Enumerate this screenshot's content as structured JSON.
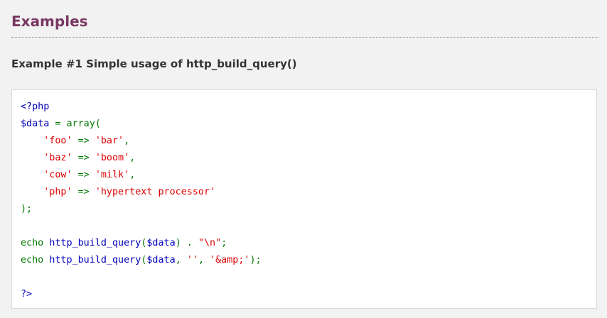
{
  "section": {
    "title": "Examples"
  },
  "example": {
    "title": "Example #1 Simple usage of http_build_query()"
  },
  "code": {
    "lines": [
      [
        {
          "text": "<?php",
          "class": "tok-keyword"
        }
      ],
      [
        {
          "text": "$data",
          "class": "tok-keyword"
        },
        {
          "text": " = array(",
          "class": "tok-default"
        }
      ],
      [
        {
          "text": "    ",
          "class": "tok-default"
        },
        {
          "text": "'foo'",
          "class": "tok-string"
        },
        {
          "text": " => ",
          "class": "tok-default"
        },
        {
          "text": "'bar'",
          "class": "tok-string"
        },
        {
          "text": ",",
          "class": "tok-default"
        }
      ],
      [
        {
          "text": "    ",
          "class": "tok-default"
        },
        {
          "text": "'baz'",
          "class": "tok-string"
        },
        {
          "text": " => ",
          "class": "tok-default"
        },
        {
          "text": "'boom'",
          "class": "tok-string"
        },
        {
          "text": ",",
          "class": "tok-default"
        }
      ],
      [
        {
          "text": "    ",
          "class": "tok-default"
        },
        {
          "text": "'cow'",
          "class": "tok-string"
        },
        {
          "text": " => ",
          "class": "tok-default"
        },
        {
          "text": "'milk'",
          "class": "tok-string"
        },
        {
          "text": ",",
          "class": "tok-default"
        }
      ],
      [
        {
          "text": "    ",
          "class": "tok-default"
        },
        {
          "text": "'php'",
          "class": "tok-string"
        },
        {
          "text": " => ",
          "class": "tok-default"
        },
        {
          "text": "'hypertext processor'",
          "class": "tok-string"
        }
      ],
      [
        {
          "text": ");",
          "class": "tok-default"
        }
      ],
      [],
      [
        {
          "text": "echo ",
          "class": "tok-default"
        },
        {
          "text": "http_build_query",
          "class": "tok-keyword"
        },
        {
          "text": "(",
          "class": "tok-default"
        },
        {
          "text": "$data",
          "class": "tok-keyword"
        },
        {
          "text": ") . ",
          "class": "tok-default"
        },
        {
          "text": "\"\\n\"",
          "class": "tok-string"
        },
        {
          "text": ";",
          "class": "tok-default"
        }
      ],
      [
        {
          "text": "echo ",
          "class": "tok-default"
        },
        {
          "text": "http_build_query",
          "class": "tok-keyword"
        },
        {
          "text": "(",
          "class": "tok-default"
        },
        {
          "text": "$data",
          "class": "tok-keyword"
        },
        {
          "text": ", ",
          "class": "tok-default"
        },
        {
          "text": "''",
          "class": "tok-string"
        },
        {
          "text": ", ",
          "class": "tok-default"
        },
        {
          "text": "'&amp;'",
          "class": "tok-string"
        },
        {
          "text": ");",
          "class": "tok-default"
        }
      ],
      [],
      [
        {
          "text": "?>",
          "class": "tok-keyword"
        }
      ]
    ]
  },
  "colors": {
    "page_background": "#f2f2f2",
    "section_title": "#793862",
    "keyword": "#0000bb",
    "string": "#dd0000",
    "default": "#007700"
  }
}
